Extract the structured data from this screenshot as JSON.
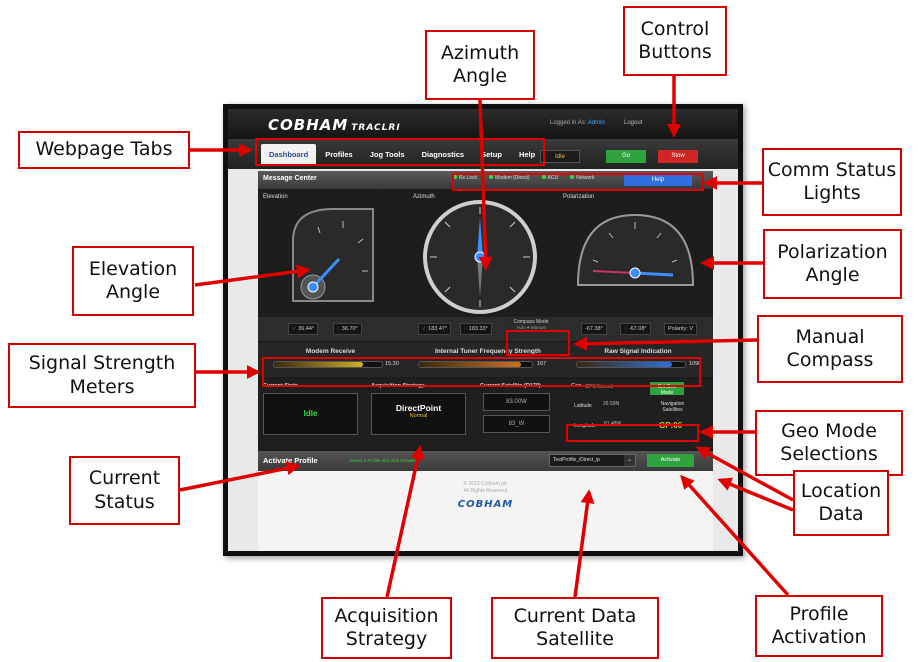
{
  "app": {
    "logo": "COBHAM",
    "logo_sub": "TRACLRI",
    "logged_in_label": "Logged in As:",
    "user": "Admin",
    "logout": "Logout",
    "footer_copyright": "© 2013 Cobham plc\nAll Rights Reserved",
    "footer_logo": "COBHAM"
  },
  "tabs": [
    "Dashboard",
    "Profiles",
    "Jog Tools",
    "Diagnostics",
    "Setup",
    "Help"
  ],
  "control_buttons": {
    "idle": "Idle",
    "go": "Go",
    "stow": "Stow"
  },
  "message_center": {
    "title": "Message Center",
    "lights": [
      "Rx Lock",
      "Modem (Direct)",
      "ACU",
      "Network"
    ],
    "help": "Help"
  },
  "gauges": {
    "elevation": {
      "label": "Elevation",
      "actual": "36.44°",
      "target": "36.70°"
    },
    "azimuth": {
      "label": "Azimuth",
      "actual": "183.47°",
      "target": "183.33°"
    },
    "polarization": {
      "label": "Polarization",
      "actual": "-67.38°",
      "target": "-67.08°",
      "mode": "Polarity: V"
    }
  },
  "compass": {
    "title": "Compass Mode",
    "auto": "Auto",
    "manual": "Manual"
  },
  "meters": [
    {
      "label": "Modem Receive",
      "value": "15.30",
      "level": 0.82,
      "color": "#d4b020"
    },
    {
      "label": "Internal Tuner Frequency Strength",
      "value": "167",
      "level": 0.9,
      "color": "#d07020"
    },
    {
      "label": "Raw Signal Indication",
      "value": "1096",
      "level": 0.88,
      "color": "#2f6fe0"
    }
  ],
  "status": {
    "current_state_label": "Current State",
    "current_state": "Idle",
    "acq_label": "Acquisition Strategy",
    "acq_value": "DirectPoint",
    "acq_sub": "Normal",
    "sat_label": "Current Satellite (D170)",
    "sat_value_1": "83.00W",
    "sat_value_2": "83_W"
  },
  "geo": {
    "label": "Geo",
    "mode": "GPS Normal",
    "set_button": "Set Geo\nMode",
    "latitude_label": "Latitude",
    "latitude": "26.59N",
    "longitude_label": "Longitude",
    "longitude": "81.48W",
    "nav_label": "Navigation\nSatellites",
    "gp": "GP:06"
  },
  "activate": {
    "title": "Activate Profile",
    "subtitle": "Select a Profile and click Activate",
    "profile": "TestProfile_iDirect_ip",
    "button": "Activate"
  },
  "annotations": {
    "webpage_tabs": "Webpage Tabs",
    "azimuth_angle": "Azimuth\nAngle",
    "control_buttons": "Control\nButtons",
    "comm_status_lights": "Comm Status\nLights",
    "elevation_angle": "Elevation\nAngle",
    "polarization_angle": "Polarization\nAngle",
    "signal_strength_meters": "Signal Strength\nMeters",
    "manual_compass": "Manual\nCompass",
    "geo_mode_selections": "Geo Mode\nSelections",
    "current_status": "Current\nStatus",
    "location_data": "Location\nData",
    "acquisition_strategy": "Acquisition\nStrategy",
    "current_data_satellite": "Current Data\nSatellite",
    "profile_activation": "Profile\nActivation"
  }
}
